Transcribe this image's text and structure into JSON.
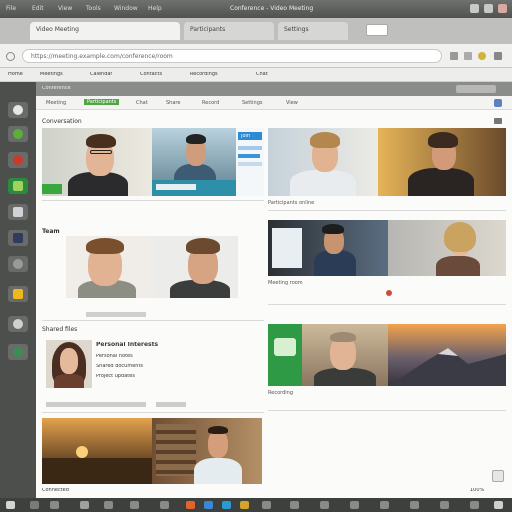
{
  "window": {
    "title": "Conference - Video Meeting",
    "menu": [
      "File",
      "Edit",
      "View",
      "Tools",
      "Window",
      "Help"
    ]
  },
  "browser": {
    "tabs": [
      {
        "label": "Video Meeting"
      },
      {
        "label": "Participants"
      },
      {
        "label": "Settings"
      }
    ],
    "url": "https://meeting.example.com/conference/room",
    "bookmarks": [
      "Home",
      "Meetings",
      "Calendar",
      "Contacts",
      "Recordings",
      "Chat"
    ]
  },
  "app": {
    "header": "Conference",
    "toolbar": [
      "Meeting",
      "Participants",
      "Chat",
      "Share",
      "Record",
      "Settings",
      "View"
    ],
    "rail_icons": [
      "home-icon",
      "refresh-icon",
      "record-icon",
      "calendar-icon",
      "camera-icon",
      "chat-icon",
      "contacts-icon",
      "folder-icon",
      "settings-icon",
      "help-icon"
    ]
  },
  "sections": {
    "top_left": "Conversation",
    "mid_left": "Team",
    "lower_left": "Shared files",
    "top_right_caption": "Participants online",
    "mid_right_caption": "Meeting room",
    "lower_right_caption": "Recording"
  },
  "cards": {
    "lower_left_title": "Personal Interests",
    "lower_left_lines": [
      "Personal notes",
      "Shared documents",
      "Project updates"
    ],
    "top_left_button": "Join"
  },
  "status": {
    "footer_left": "Connected",
    "footer_right": "100%"
  }
}
